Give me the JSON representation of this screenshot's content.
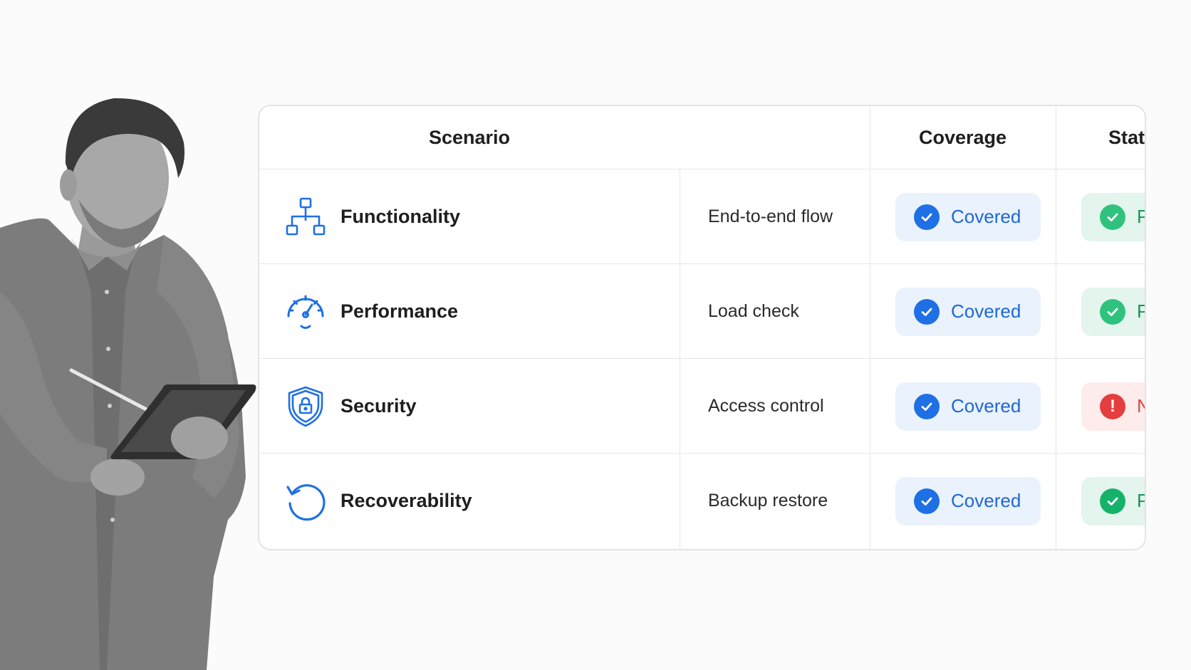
{
  "table": {
    "headers": {
      "scenario": "Scenario",
      "coverage": "Coverage",
      "status": "Status"
    },
    "rows": [
      {
        "icon": "hierarchy-icon",
        "name": "Functionality",
        "detail": "End-to-end flow",
        "coverage": "Covered",
        "status": "PASS",
        "status_type": "pass"
      },
      {
        "icon": "gauge-icon",
        "name": "Performance",
        "detail": "Load check",
        "coverage": "Covered",
        "status": "PASS",
        "status_type": "pass"
      },
      {
        "icon": "shield-lock-icon",
        "name": "Security",
        "detail": "Access control",
        "coverage": "Covered",
        "status": "Needs review",
        "status_type": "review"
      },
      {
        "icon": "refresh-icon",
        "name": "Recoverability",
        "detail": "Backup restore",
        "coverage": "Covered",
        "status": "PASS",
        "status_type": "pass"
      }
    ]
  },
  "colors": {
    "accent_blue": "#1f6fe5",
    "pass_green": "#2fc27e",
    "review_red": "#e53e3e"
  },
  "review_mark": "!"
}
